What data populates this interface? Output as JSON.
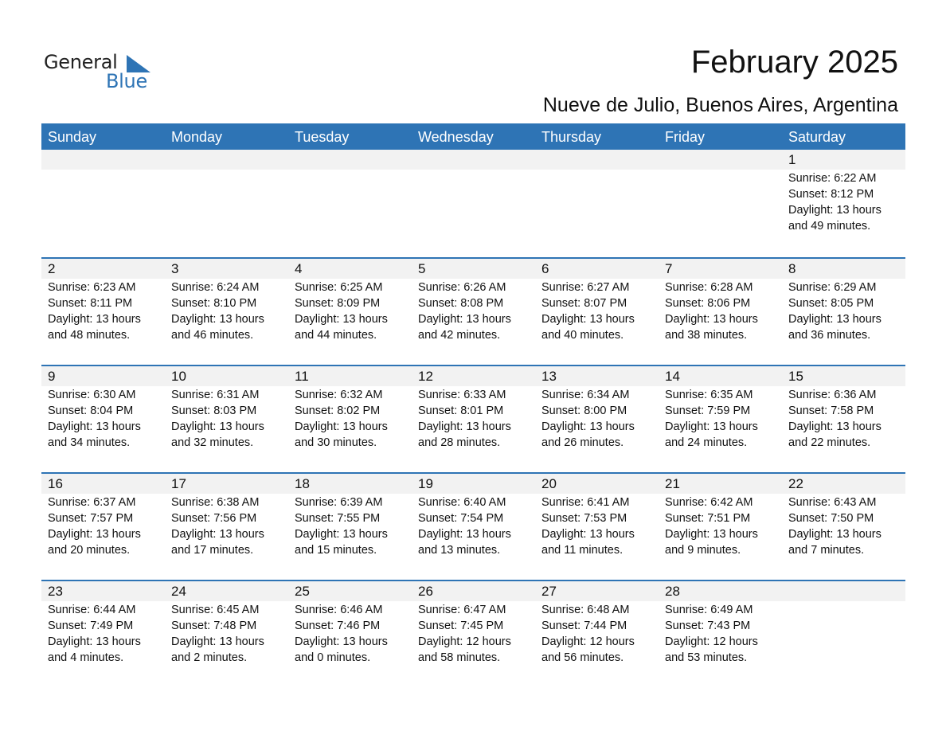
{
  "logo": {
    "text_general": "General",
    "text_blue": "Blue",
    "icon": "triangle-flag-icon",
    "brand_color": "#2e74b5"
  },
  "header": {
    "title": "February 2025",
    "subtitle": "Nueve de Julio, Buenos Aires, Argentina"
  },
  "colors": {
    "header_bg": "#2e74b5",
    "band_bg": "#f2f2f2",
    "text": "#111111"
  },
  "weekdays": [
    "Sunday",
    "Monday",
    "Tuesday",
    "Wednesday",
    "Thursday",
    "Friday",
    "Saturday"
  ],
  "weeks": [
    [
      null,
      null,
      null,
      null,
      null,
      null,
      {
        "day": "1",
        "sunrise": "Sunrise: 6:22 AM",
        "sunset": "Sunset: 8:12 PM",
        "daylight1": "Daylight: 13 hours",
        "daylight2": "and 49 minutes."
      }
    ],
    [
      {
        "day": "2",
        "sunrise": "Sunrise: 6:23 AM",
        "sunset": "Sunset: 8:11 PM",
        "daylight1": "Daylight: 13 hours",
        "daylight2": "and 48 minutes."
      },
      {
        "day": "3",
        "sunrise": "Sunrise: 6:24 AM",
        "sunset": "Sunset: 8:10 PM",
        "daylight1": "Daylight: 13 hours",
        "daylight2": "and 46 minutes."
      },
      {
        "day": "4",
        "sunrise": "Sunrise: 6:25 AM",
        "sunset": "Sunset: 8:09 PM",
        "daylight1": "Daylight: 13 hours",
        "daylight2": "and 44 minutes."
      },
      {
        "day": "5",
        "sunrise": "Sunrise: 6:26 AM",
        "sunset": "Sunset: 8:08 PM",
        "daylight1": "Daylight: 13 hours",
        "daylight2": "and 42 minutes."
      },
      {
        "day": "6",
        "sunrise": "Sunrise: 6:27 AM",
        "sunset": "Sunset: 8:07 PM",
        "daylight1": "Daylight: 13 hours",
        "daylight2": "and 40 minutes."
      },
      {
        "day": "7",
        "sunrise": "Sunrise: 6:28 AM",
        "sunset": "Sunset: 8:06 PM",
        "daylight1": "Daylight: 13 hours",
        "daylight2": "and 38 minutes."
      },
      {
        "day": "8",
        "sunrise": "Sunrise: 6:29 AM",
        "sunset": "Sunset: 8:05 PM",
        "daylight1": "Daylight: 13 hours",
        "daylight2": "and 36 minutes."
      }
    ],
    [
      {
        "day": "9",
        "sunrise": "Sunrise: 6:30 AM",
        "sunset": "Sunset: 8:04 PM",
        "daylight1": "Daylight: 13 hours",
        "daylight2": "and 34 minutes."
      },
      {
        "day": "10",
        "sunrise": "Sunrise: 6:31 AM",
        "sunset": "Sunset: 8:03 PM",
        "daylight1": "Daylight: 13 hours",
        "daylight2": "and 32 minutes."
      },
      {
        "day": "11",
        "sunrise": "Sunrise: 6:32 AM",
        "sunset": "Sunset: 8:02 PM",
        "daylight1": "Daylight: 13 hours",
        "daylight2": "and 30 minutes."
      },
      {
        "day": "12",
        "sunrise": "Sunrise: 6:33 AM",
        "sunset": "Sunset: 8:01 PM",
        "daylight1": "Daylight: 13 hours",
        "daylight2": "and 28 minutes."
      },
      {
        "day": "13",
        "sunrise": "Sunrise: 6:34 AM",
        "sunset": "Sunset: 8:00 PM",
        "daylight1": "Daylight: 13 hours",
        "daylight2": "and 26 minutes."
      },
      {
        "day": "14",
        "sunrise": "Sunrise: 6:35 AM",
        "sunset": "Sunset: 7:59 PM",
        "daylight1": "Daylight: 13 hours",
        "daylight2": "and 24 minutes."
      },
      {
        "day": "15",
        "sunrise": "Sunrise: 6:36 AM",
        "sunset": "Sunset: 7:58 PM",
        "daylight1": "Daylight: 13 hours",
        "daylight2": "and 22 minutes."
      }
    ],
    [
      {
        "day": "16",
        "sunrise": "Sunrise: 6:37 AM",
        "sunset": "Sunset: 7:57 PM",
        "daylight1": "Daylight: 13 hours",
        "daylight2": "and 20 minutes."
      },
      {
        "day": "17",
        "sunrise": "Sunrise: 6:38 AM",
        "sunset": "Sunset: 7:56 PM",
        "daylight1": "Daylight: 13 hours",
        "daylight2": "and 17 minutes."
      },
      {
        "day": "18",
        "sunrise": "Sunrise: 6:39 AM",
        "sunset": "Sunset: 7:55 PM",
        "daylight1": "Daylight: 13 hours",
        "daylight2": "and 15 minutes."
      },
      {
        "day": "19",
        "sunrise": "Sunrise: 6:40 AM",
        "sunset": "Sunset: 7:54 PM",
        "daylight1": "Daylight: 13 hours",
        "daylight2": "and 13 minutes."
      },
      {
        "day": "20",
        "sunrise": "Sunrise: 6:41 AM",
        "sunset": "Sunset: 7:53 PM",
        "daylight1": "Daylight: 13 hours",
        "daylight2": "and 11 minutes."
      },
      {
        "day": "21",
        "sunrise": "Sunrise: 6:42 AM",
        "sunset": "Sunset: 7:51 PM",
        "daylight1": "Daylight: 13 hours",
        "daylight2": "and 9 minutes."
      },
      {
        "day": "22",
        "sunrise": "Sunrise: 6:43 AM",
        "sunset": "Sunset: 7:50 PM",
        "daylight1": "Daylight: 13 hours",
        "daylight2": "and 7 minutes."
      }
    ],
    [
      {
        "day": "23",
        "sunrise": "Sunrise: 6:44 AM",
        "sunset": "Sunset: 7:49 PM",
        "daylight1": "Daylight: 13 hours",
        "daylight2": "and 4 minutes."
      },
      {
        "day": "24",
        "sunrise": "Sunrise: 6:45 AM",
        "sunset": "Sunset: 7:48 PM",
        "daylight1": "Daylight: 13 hours",
        "daylight2": "and 2 minutes."
      },
      {
        "day": "25",
        "sunrise": "Sunrise: 6:46 AM",
        "sunset": "Sunset: 7:46 PM",
        "daylight1": "Daylight: 13 hours",
        "daylight2": "and 0 minutes."
      },
      {
        "day": "26",
        "sunrise": "Sunrise: 6:47 AM",
        "sunset": "Sunset: 7:45 PM",
        "daylight1": "Daylight: 12 hours",
        "daylight2": "and 58 minutes."
      },
      {
        "day": "27",
        "sunrise": "Sunrise: 6:48 AM",
        "sunset": "Sunset: 7:44 PM",
        "daylight1": "Daylight: 12 hours",
        "daylight2": "and 56 minutes."
      },
      {
        "day": "28",
        "sunrise": "Sunrise: 6:49 AM",
        "sunset": "Sunset: 7:43 PM",
        "daylight1": "Daylight: 12 hours",
        "daylight2": "and 53 minutes."
      },
      null
    ]
  ]
}
